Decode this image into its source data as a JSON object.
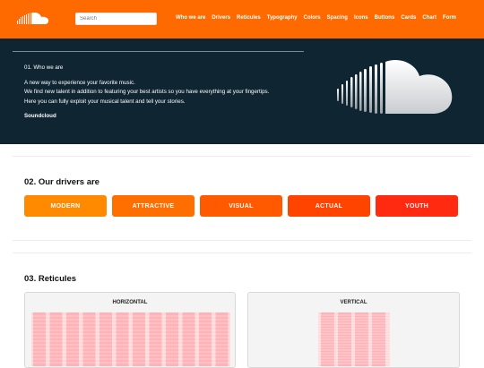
{
  "header": {
    "search_placeholder": "Search",
    "nav": [
      "Who we are",
      "Drivers",
      "Reticules",
      "Typography",
      "Colors",
      "Spacing",
      "Icons",
      "Buttons",
      "Cards",
      "Chart",
      "Form"
    ],
    "logo_icon": "soundcloud-logo-icon"
  },
  "hero": {
    "label": "01. Who we are",
    "line1": "A new way to experience your favorite music.",
    "line2": "We find new talent in addition to featuring your best artists so you have everything at your fingertips.",
    "line3": "Here you can fully exploit your musical talent and tell your stories.",
    "brand": "Soundcloud",
    "logo_icon": "soundcloud-cloud-icon"
  },
  "drivers": {
    "title": "02. Our drivers are",
    "items": [
      {
        "label": "MODERN",
        "color": "#ff8a00"
      },
      {
        "label": "ATTRACTIVE",
        "color": "#ff6f00"
      },
      {
        "label": "VISUAL",
        "color": "#ff5a00"
      },
      {
        "label": "ACTUAL",
        "color": "#ff4400"
      },
      {
        "label": "YOUTH",
        "color": "#ff2a10"
      }
    ]
  },
  "reticules": {
    "title": "03. Reticules",
    "horizontal": "HORIZONTAL",
    "vertical": "VERTICAL"
  },
  "colors": {
    "accent": "#ff6a00",
    "hero_bg": "#0f2532"
  }
}
